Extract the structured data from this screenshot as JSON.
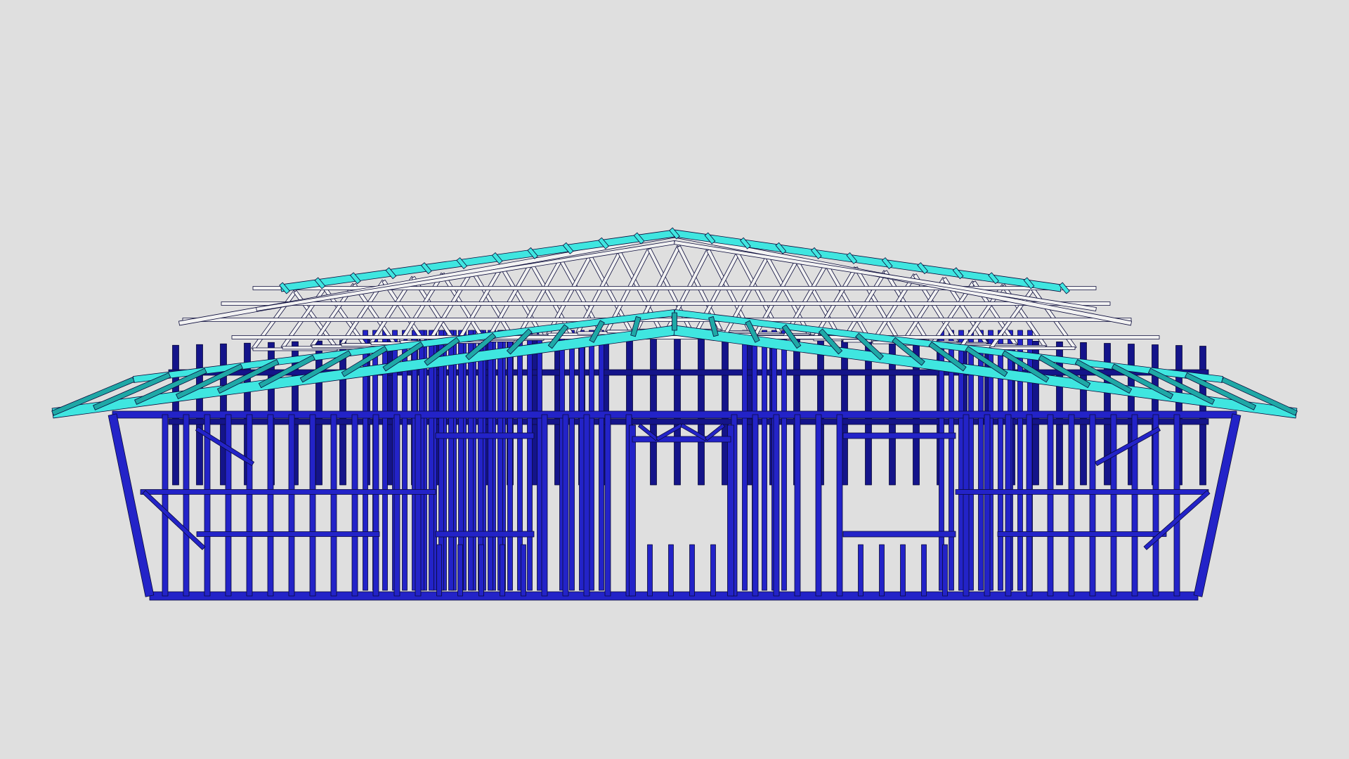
{
  "viewport": {
    "background": "#dfdfdf"
  },
  "model": {
    "subject": "steel-frame-house",
    "colors": {
      "wall_frame": "#2323c8",
      "wall_frame_dark": "#14148a",
      "roof_batten": "#3fe6e0",
      "roof_batten_dark": "#1fa8a6",
      "truss": "#f2f2f2",
      "outline": "#0a0a3a"
    }
  }
}
